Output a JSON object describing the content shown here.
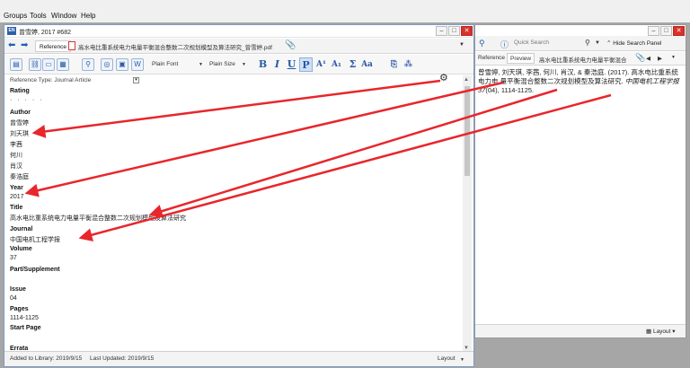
{
  "menu": [
    "Groups",
    "Tools",
    "Window",
    "Help"
  ],
  "ref_window": {
    "title": "曾雪婷, 2017 #682",
    "icon_label": "EN",
    "tab_reference": "Reference",
    "pdf_name": "高水电比重系统电力电量平衡混合整数二次规划模型及算法研究_曾雪婷.pdf",
    "font_family": "Plain Font",
    "font_size": "Plain Size",
    "reference_type_label": "Reference Type:",
    "reference_type_value": "Journal Article",
    "fields": {
      "rating_label": "Rating",
      "rating_value": "· · · · ·",
      "author_label": "Author",
      "authors": [
        "曾雪婷",
        "刘天琪",
        "李茜",
        "何川",
        "肖汉",
        "秦浩庭"
      ],
      "year_label": "Year",
      "year_value": "2017",
      "title_label": "Title",
      "title_value": "高水电比重系统电力电量平衡混合整数二次规划模型及算法研究",
      "journal_label": "Journal",
      "journal_value": "中国电机工程学报",
      "volume_label": "Volume",
      "volume_value": "37",
      "part_label": "Part/Supplement",
      "issue_label": "Issue",
      "issue_value": "04",
      "pages_label": "Pages",
      "pages_value": "1114-1125",
      "start_page_label": "Start Page",
      "errata_label": "Errata"
    },
    "status": {
      "added": "Added to Library: 2019/9/15",
      "updated": "Last Updated: 2019/9/15",
      "layout": "Layout"
    }
  },
  "right_window": {
    "search_placeholder": "Quick Search",
    "hide_search": "Hide Search Panel",
    "tab_reference": "Reference",
    "tab_preview": "Preview",
    "pdf_name": "高水电比重系统电力电量平衡混合",
    "preview_line1": "曾雪婷, 刘天琪, 李茜, 何川, 肖汉, & 秦浩庭. (2017). 高水电比重系统电力电",
    "preview_line2": "量平衡混合整数二次规划模型及算法研究.",
    "preview_journal": "中国电机工程学报",
    "preview_volume": "37",
    "preview_rest": "(04), 1114-1125.",
    "layout": "Layout"
  },
  "colors": {
    "arrow": "#e8262b",
    "accent": "#2a5aa5"
  }
}
